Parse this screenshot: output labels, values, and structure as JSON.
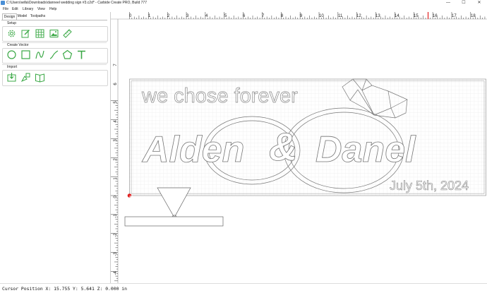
{
  "window": {
    "title": "C:\\Users\\willa\\Downloads\\danneel wedding sign #3.c2d* - Carbide Create PRO, Build 777",
    "minimize_glyph": "—",
    "maximize_glyph": "☐",
    "close_glyph": "✕"
  },
  "menu": [
    "File",
    "Edit",
    "Library",
    "View",
    "Help"
  ],
  "tabs": [
    {
      "label": "Design",
      "active": true
    },
    {
      "label": "Model",
      "active": false
    },
    {
      "label": "Toolpaths",
      "active": false
    }
  ],
  "sections": {
    "setup": {
      "label": "Setup",
      "tools": [
        "gear-icon",
        "edit-icon",
        "grid-icon",
        "image-icon",
        "ruler-icon"
      ]
    },
    "create_vector": {
      "label": "Create Vector",
      "tools": [
        "circle-icon",
        "rectangle-icon",
        "curve-icon",
        "polyline-icon",
        "polygon-icon",
        "text-icon"
      ]
    },
    "import": {
      "label": "Import",
      "tools": [
        "import-icon",
        "component-icon",
        "library-icon"
      ]
    }
  },
  "ruler": {
    "h_labels": [
      "0",
      "1",
      "2",
      "3",
      "4",
      "5",
      "6",
      "7",
      "8",
      "9",
      "10",
      "11",
      "12",
      "13",
      "14",
      "15",
      "16",
      "17",
      "18"
    ],
    "v_labels": [
      "7",
      "6",
      "5",
      "4",
      "3",
      "2",
      "1",
      "0",
      "-1",
      "-2",
      "-3",
      "-4"
    ],
    "cursor_x": 15.755,
    "cursor_y": 5.641
  },
  "design": {
    "line1": "we chose forever",
    "line2_left": "Alden",
    "ampersand": "&",
    "line2_right": "Danel",
    "date": "July 5th, 2024"
  },
  "colors": {
    "tool_icon": "#3aa845",
    "grid": "#e4e4e4",
    "ruler_cursor": "#e02020",
    "origin": "#e02020",
    "outline": "#777777"
  },
  "status": {
    "text": "Cursor Position X: 15.755 Y: 5.641 Z: 0.000 in"
  }
}
